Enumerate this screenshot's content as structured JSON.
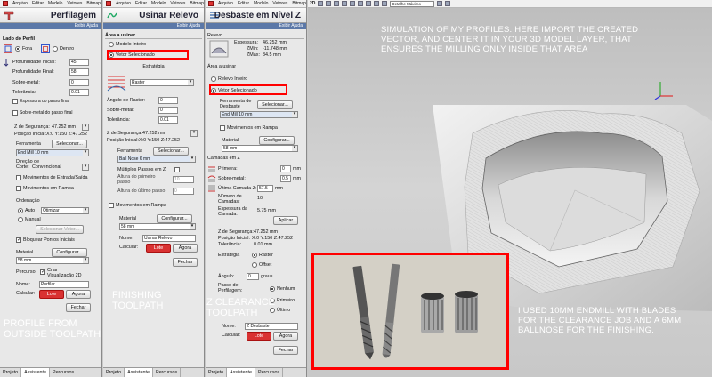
{
  "menu": {
    "items": [
      "Arquivo",
      "Editar",
      "Modelo",
      "Vetores",
      "Bitmap",
      "Relevos",
      "Percursos",
      "Janela",
      "Ajuda"
    ]
  },
  "view_tag": "2D",
  "view_combo": "Detalhe Máximo",
  "help_label": "Exibir Ajuda",
  "tabs": [
    "Projeto",
    "Assistente",
    "Percursos"
  ],
  "panel1": {
    "title": "Perfilagem",
    "side_heading": "Lado do Perfil",
    "side_options": [
      "Fora",
      "Dentro"
    ],
    "profile_depth_start_label": "Profundidade Inicial:",
    "profile_depth_start": "45",
    "profile_depth_final_label": "Profundidade Final:",
    "profile_depth_final": "58",
    "allowance_label": "Sobre-metal:",
    "allowance": "0",
    "tolerance_label": "Tolerância:",
    "tolerance": "0.01",
    "final_pass_thickness": "Espessura do passo final",
    "final_pass_allowance": "Sobre-metal do passo final",
    "safe_z_label": "Z de Segurança:",
    "safe_z": "47.252 mm",
    "start_pos_label": "Posição Inicial:",
    "start_pos": "X:0 Y:150 Z:47.252",
    "tool_label": "Ferramenta",
    "select_label": "Selecionar...",
    "tool_name": "End Mill 10 mm",
    "cut_dir_label": "Direção de Corte:",
    "cut_dir": "Convencional",
    "lead_moves": "Movimentos de Entrada/Saída",
    "ramp_moves": "Movimentos em Rampa",
    "ordering_label": "Ordenação",
    "auto_label": "Auto",
    "order_value": "Otimizar",
    "manual_label": "Manual",
    "select_vector": "Selecionar Vetor...",
    "block_points": "Bloquear Pontos Iniciais",
    "material_label": "Material",
    "config_label": "Configurar...",
    "material_value": "58 mm",
    "path_label": "Percurso",
    "create_preview": "Criar Visualização 2D",
    "name_label": "Nome:",
    "name_value": "Perfilar",
    "calc_label": "Calcular:",
    "later_label": "Lote",
    "now_label": "Agora",
    "close_label": "Fechar"
  },
  "panel2": {
    "title": "Usinar Relevo",
    "area_heading": "Área a usinar",
    "model_option": "Modelo Inteiro",
    "vector_option": "Vetor Selecionado",
    "strategy_heading": "Estratégia",
    "strategy_value": "Raster",
    "raster_angle_label": "Ângulo de Raster:",
    "raster_angle": "0",
    "allowance_label": "Sobre-metal:",
    "allowance": "0",
    "tolerance_label": "Tolerância:",
    "tolerance": "0.01",
    "safe_z_label": "Z de Segurança:",
    "safe_z": "47.252 mm",
    "start_pos_label": "Posição Inicial:",
    "start_pos": "X:0 Y:150 Z:47.252",
    "tool_label": "Ferramenta",
    "select_label": "Selecionar...",
    "tool_name": "Ball Nose 6 mm",
    "multi_pass": "Múltiplos Passos em Z",
    "first_pass_label": "Altura do primeiro passo",
    "first_pass": "10",
    "last_pass_label": "Altura do último passo",
    "last_pass": "0",
    "ramp_moves": "Movimentos em Rampa",
    "material_label": "Material",
    "config_label": "Configurar...",
    "material_value": "58 mm",
    "name_label": "Nome:",
    "name_value": "Usinar Relevo",
    "calc_label": "Calcular:",
    "later_label": "Lote",
    "now_label": "Agora",
    "close_label": "Fechar"
  },
  "panel3": {
    "title": "Desbaste em Nível Z",
    "relief_heading": "Relevo",
    "thickness_label": "Espessura:",
    "thickness": "46.252 mm",
    "zmin_label": "ZMin:",
    "zmin": "-11.748 mm",
    "zmax_label": "ZMax:",
    "zmax": "34.5 mm",
    "area_heading": "Área a usinar",
    "relief_option": "Relevo Inteiro",
    "vector_option": "Vetor Selecionado",
    "clear_tool_label": "Ferramenta de Desbaste",
    "select_label": "Selecionar...",
    "tool_name": "End Mill 10 mm",
    "material_label": "Material",
    "config_label": "Configurar...",
    "material_value": "58 mm",
    "ramp_moves": "Movimentos em Rampa",
    "z_layers_heading": "Camadas em Z",
    "first_label": "Primeira:",
    "first": "0",
    "allowance_label": "Sobre-metal:",
    "allowance": "0.5",
    "last_layer_label": "Última Camada Z:",
    "last_layer": "57.5",
    "layers_count_label": "Número de Camadas:",
    "layers_count": "10",
    "layer_thickness_label": "Espessura da Camada:",
    "layer_thickness": "5.75 mm",
    "apply_label": "Aplicar",
    "safe_z_label": "Z de Segurança:",
    "safe_z": "47.252 mm",
    "start_pos_label": "Posição Inicial:",
    "start_pos": "X:0 Y:150 Z:47.252",
    "tolerance_label": "Tolerância:",
    "tolerance": "0.01 mm",
    "strategy_label": "Estratégia",
    "strat_raster": "Raster",
    "strat_offset": "Offset",
    "angle_label": "Ângulo:",
    "angle": "0",
    "angle_unit": "graus",
    "profile_pass_label": "Passo de Perfilagem:",
    "pp_none": "Nenhum",
    "pp_first": "Primeiro",
    "pp_last": "Último",
    "name_label": "Nome:",
    "name_value": "Z Desbaste",
    "calc_label": "Calcular:",
    "later_label": "Lote",
    "now_label": "Agora",
    "close_label": "Fechar"
  },
  "annotations": {
    "viewport_note": "Simulation of my profiles. Here import the created vector, and center it in your 3D model layer, that ensures the milling only inside that area",
    "tools_note": "I used 10mm endmill with blades for the clearance job and a 6mm ballnose for the finishing.",
    "finishing": "Finishing toolpath",
    "zclearance": "Z Clearance toolpath",
    "profile": "Profile from outside toolpath"
  },
  "colors": {
    "accent_red": "#ff0000",
    "help_bar": "#5b78a8",
    "button_red": "#d93232"
  }
}
